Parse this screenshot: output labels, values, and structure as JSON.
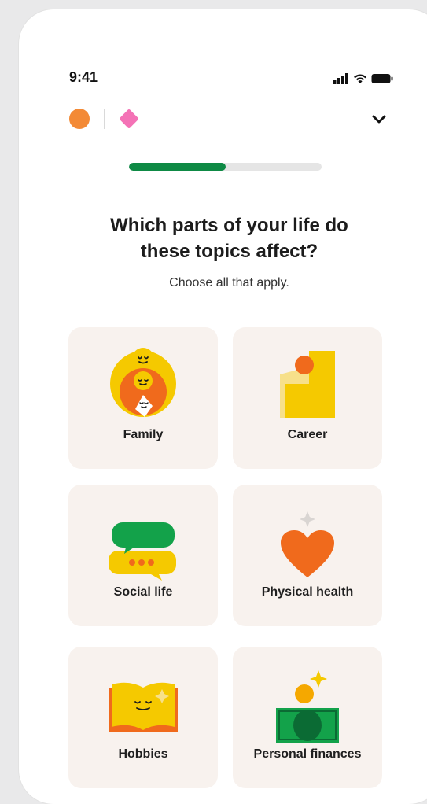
{
  "status": {
    "time": "9:41"
  },
  "progress": {
    "value": 0.5
  },
  "headline": {
    "line1": "Which parts of your life do",
    "line2": "these topics affect?"
  },
  "subtitle": "Choose all that apply.",
  "options": [
    {
      "label": "Family",
      "icon": "family-icon"
    },
    {
      "label": "Career",
      "icon": "career-icon"
    },
    {
      "label": "Social life",
      "icon": "social-life-icon"
    },
    {
      "label": "Physical health",
      "icon": "physical-health-icon"
    },
    {
      "label": "Hobbies",
      "icon": "hobbies-icon"
    },
    {
      "label": "Personal finances",
      "icon": "personal-finances-icon"
    }
  ],
  "colors": {
    "progress": "#0e8a45",
    "card": "#f8f2ee",
    "accent_orange": "#f38a36",
    "accent_pink": "#f472b6"
  }
}
